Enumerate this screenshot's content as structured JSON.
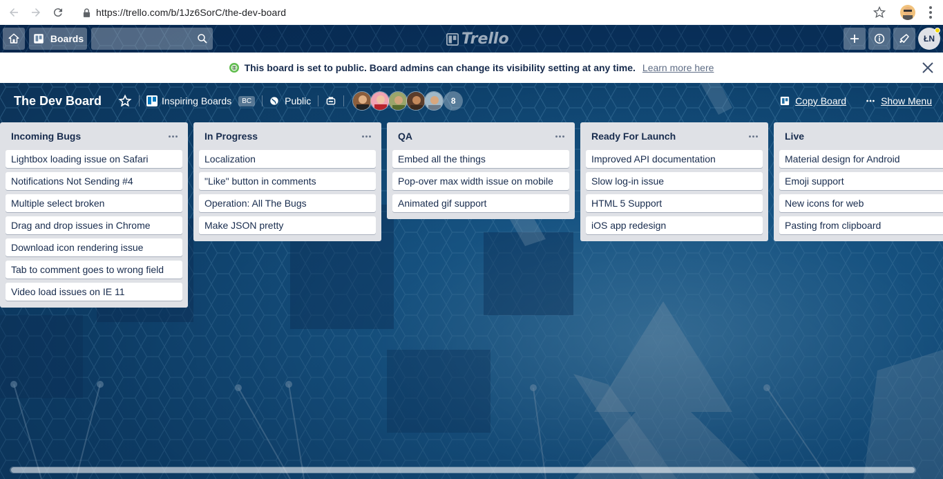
{
  "browser": {
    "url": "https://trello.com/b/1Jz6SorC/the-dev-board"
  },
  "header": {
    "boards_label": "Boards",
    "logo_text": "Trello",
    "member_initials": "ŁN"
  },
  "banner": {
    "message": "This board is set to public. Board admins can change its visibility setting at any time.",
    "link": "Learn more here"
  },
  "board": {
    "title": "The Dev Board",
    "team_name": "Inspiring Boards",
    "team_badge": "BC",
    "visibility": "Public",
    "member_count": "8",
    "copy_board": "Copy Board",
    "show_menu": "Show Menu"
  },
  "lists": [
    {
      "title": "Incoming Bugs",
      "cards": [
        "Lightbox loading issue on Safari",
        "Notifications Not Sending #4",
        "Multiple select broken",
        "Drag and drop issues in Chrome",
        "Download icon rendering issue",
        "Tab to comment goes to wrong field",
        "Video load issues on IE 11"
      ]
    },
    {
      "title": "In Progress",
      "cards": [
        "Localization",
        "\"Like\" button in comments",
        "Operation: All The Bugs",
        "Make JSON pretty"
      ]
    },
    {
      "title": "QA",
      "cards": [
        "Embed all the things",
        "Pop-over max width issue on mobile",
        "Animated gif support"
      ]
    },
    {
      "title": "Ready For Launch",
      "cards": [
        "Improved API documentation",
        "Slow log-in issue",
        "HTML 5 Support",
        "iOS app redesign"
      ]
    },
    {
      "title": "Live",
      "cards": [
        "Material design for Android",
        "Emoji support",
        "New icons for web",
        "Pasting from clipboard"
      ]
    }
  ],
  "colors": {
    "list_bg": "#dfe1e6",
    "card_bg": "#ffffff",
    "banner_icon": "#61bd4f"
  }
}
